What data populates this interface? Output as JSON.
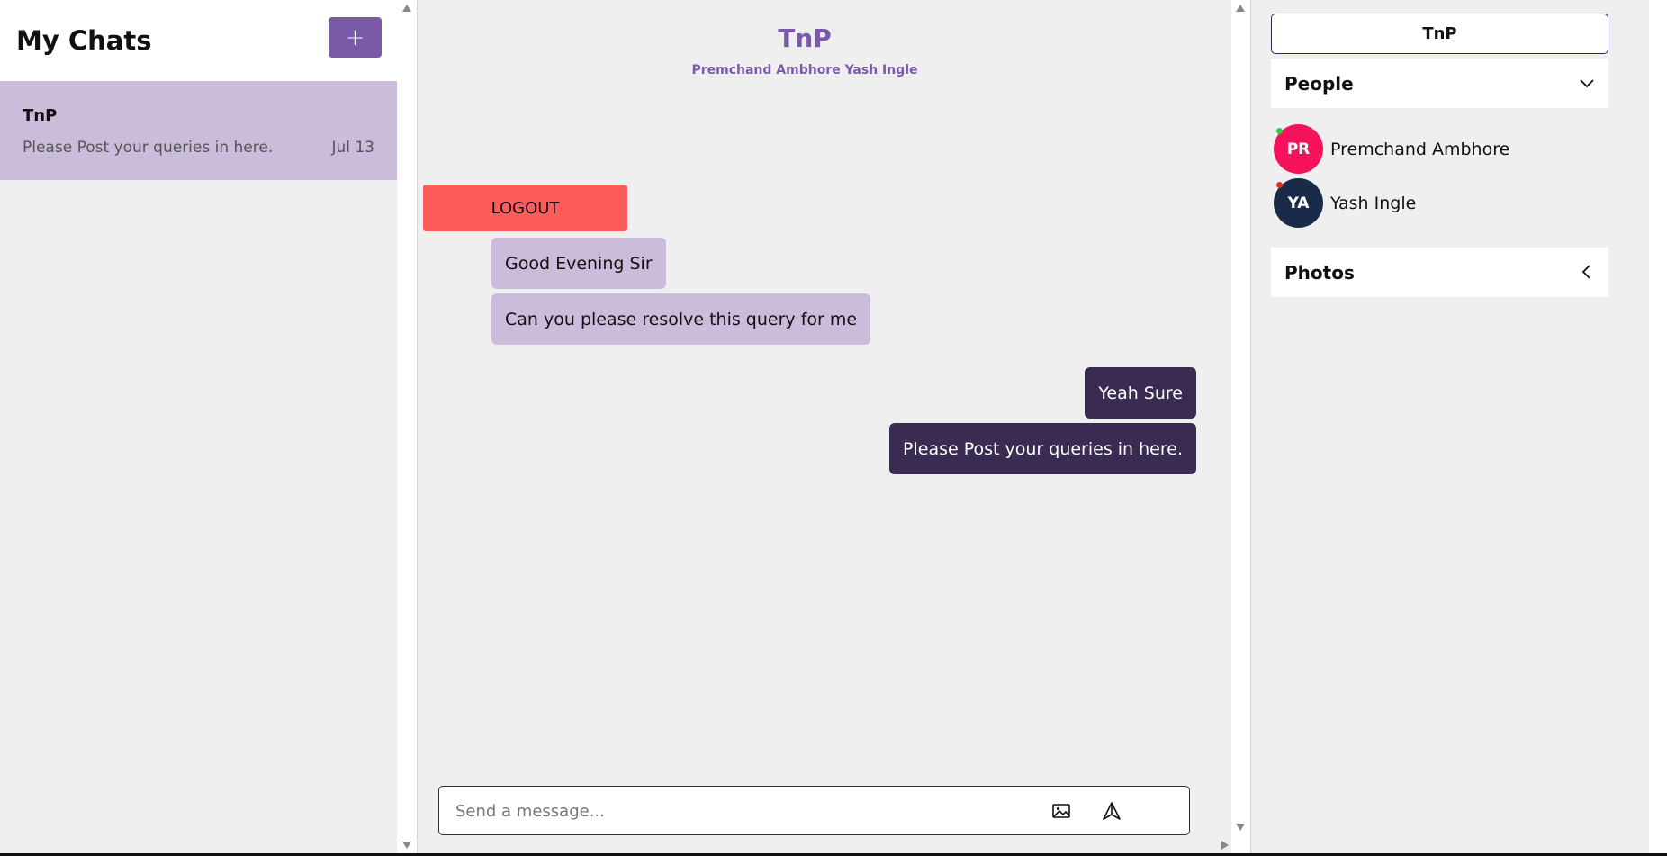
{
  "sidebar": {
    "title": "My Chats",
    "new_chat_label": "+",
    "chats": [
      {
        "name": "TnP",
        "preview": "Please Post your queries in here.",
        "date": "Jul 13"
      }
    ]
  },
  "chat": {
    "title": "TnP",
    "members": "Premchand Ambhore Yash Ingle",
    "logout_label": "LOGOUT",
    "messages": [
      {
        "text": "Good Evening Sir",
        "direction": "incoming"
      },
      {
        "text": "Can you please resolve this query for me",
        "direction": "incoming"
      },
      {
        "text": "Yeah Sure",
        "direction": "outgoing"
      },
      {
        "text": "Please Post your queries in here.",
        "direction": "outgoing"
      }
    ],
    "composer": {
      "placeholder": "Send a message...",
      "value": "",
      "image_icon": "image-icon",
      "send_icon": "send-icon"
    }
  },
  "info": {
    "group_name": "TnP",
    "people_label": "People",
    "people": [
      {
        "initials": "PR",
        "name": "Premchand Ambhore",
        "avatar_color": "#f5145c",
        "status_color": "#2ecc40"
      },
      {
        "initials": "YA",
        "name": "Yash Ingle",
        "avatar_color": "#1a2b4a",
        "status_color": "#e0312a"
      }
    ],
    "photos_label": "Photos"
  },
  "colors": {
    "accent": "#7a5aa8",
    "incoming_bubble": "#cbbcdc",
    "outgoing_bubble": "#3a2b52",
    "logout": "#fe5b5b"
  }
}
